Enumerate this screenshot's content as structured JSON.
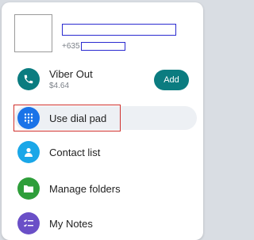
{
  "profile": {
    "phone_prefix": "+635"
  },
  "menu": {
    "viber_out": {
      "label": "Viber Out",
      "balance": "$4.64",
      "add_label": "Add",
      "icon": "phone-icon"
    },
    "dial_pad": {
      "label": "Use dial pad",
      "icon": "dialpad-icon"
    },
    "contacts": {
      "label": "Contact list",
      "icon": "person-icon"
    },
    "folders": {
      "label": "Manage folders",
      "icon": "folder-icon"
    },
    "notes": {
      "label": "My Notes",
      "icon": "notes-icon"
    }
  },
  "colors": {
    "teal": "#0b7c80",
    "blue": "#1a73e8",
    "cyan": "#1aa7e8",
    "green": "#2e9e3a",
    "purple": "#6a4fc7",
    "highlight_border": "#d0312d"
  }
}
